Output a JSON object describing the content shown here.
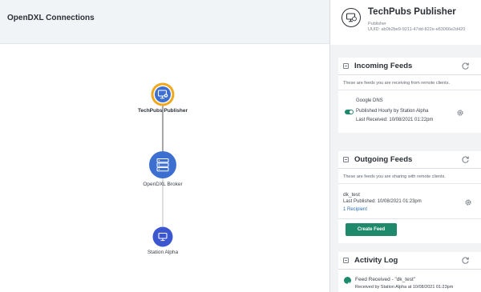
{
  "connections": {
    "title": "OpenDXL Connections",
    "nodes": [
      {
        "label": "TechPubs Publisher",
        "icon": "monitor-icon",
        "color": "#3d6fd0",
        "ring": "#f0a81e"
      },
      {
        "label": "OpenDXL Broker",
        "icon": "server-icon",
        "color": "#3d6fd0"
      },
      {
        "label": "Station Alpha",
        "icon": "monitor-icon",
        "color": "#3b56cf"
      }
    ]
  },
  "publisher": {
    "name": "TechPubs Publisher",
    "type": "Publisher",
    "uuid": "UUID: ab0b2be9-9211-47dd-822e-e83066e2d420"
  },
  "incoming": {
    "title": "Incoming Feeds",
    "description": "These are feeds you are receiving from remote clients.",
    "feed": {
      "name": "Google DNS",
      "schedule": "Published Hourly by Station Alpha",
      "received": "Last Received: 10/08/2021 01:22pm",
      "enabled": true
    }
  },
  "outgoing": {
    "title": "Outgoing Feeds",
    "description": "These are feeds you are sharing with remote clients.",
    "feed": {
      "name": "dk_test",
      "published": "Last Published: 10/08/2021 01:23pm",
      "recipients": "1 Recipient"
    },
    "create_label": "Create Feed"
  },
  "activity": {
    "title": "Activity Log",
    "entry_title": "Feed Received - \"dk_test\"",
    "entry_detail": "Received by Station Alpha at 10/08/2021 01:23pm"
  },
  "colors": {
    "accent": "#1e8a6b",
    "link": "#2f6fb3",
    "node": "#3d6fd0",
    "ring": "#f0a81e"
  }
}
